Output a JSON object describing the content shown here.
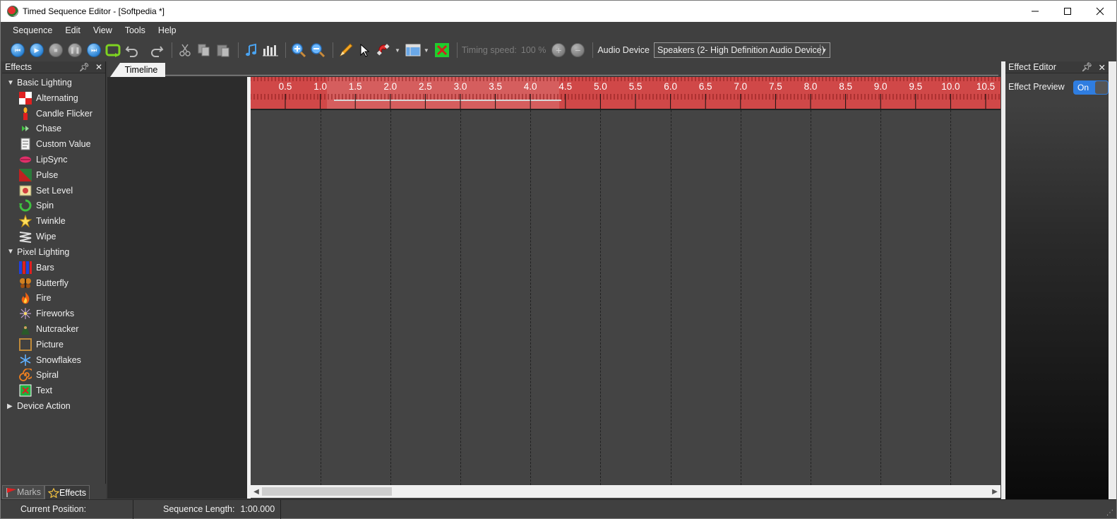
{
  "window": {
    "title": "Timed Sequence Editor - [Softpedia *]"
  },
  "menu": [
    "Sequence",
    "Edit",
    "View",
    "Tools",
    "Help"
  ],
  "toolbar": {
    "timing_speed_label": "Timing speed:",
    "timing_speed_value": "100 %",
    "audio_device_label": "Audio Device",
    "audio_device_value": "Speakers (2- High Definition Audio Device)"
  },
  "effects_panel": {
    "title": "Effects",
    "groups": [
      {
        "label": "Basic Lighting",
        "expanded": true,
        "items": [
          "Alternating",
          "Candle Flicker",
          "Chase",
          "Custom Value",
          "LipSync",
          "Pulse",
          "Set Level",
          "Spin",
          "Twinkle",
          "Wipe"
        ]
      },
      {
        "label": "Pixel Lighting",
        "expanded": true,
        "items": [
          "Bars",
          "Butterfly",
          "Fire",
          "Fireworks",
          "Nutcracker",
          "Picture",
          "Snowflakes",
          "Spiral",
          "Text"
        ]
      },
      {
        "label": "Device Action",
        "expanded": false,
        "items": []
      }
    ],
    "bottom_tabs": [
      "Marks",
      "Effects"
    ]
  },
  "timeline": {
    "tab_label": "Timeline",
    "ruler_labels": [
      "0.5",
      "1.0",
      "1.5",
      "2.0",
      "2.5",
      "3.0",
      "3.5",
      "4.0",
      "4.5",
      "5.0",
      "5.5",
      "6.0",
      "6.5",
      "7.0",
      "7.5",
      "8.0",
      "8.5",
      "9.0",
      "9.5",
      "10.0",
      "10.5"
    ]
  },
  "effect_editor": {
    "title": "Effect Editor",
    "preview_label": "Effect Preview",
    "preview_toggle": "On"
  },
  "status": {
    "current_position_label": "Current Position:",
    "current_position_value": "",
    "sequence_length_label": "Sequence Length:",
    "sequence_length_value": "1:00.000"
  }
}
